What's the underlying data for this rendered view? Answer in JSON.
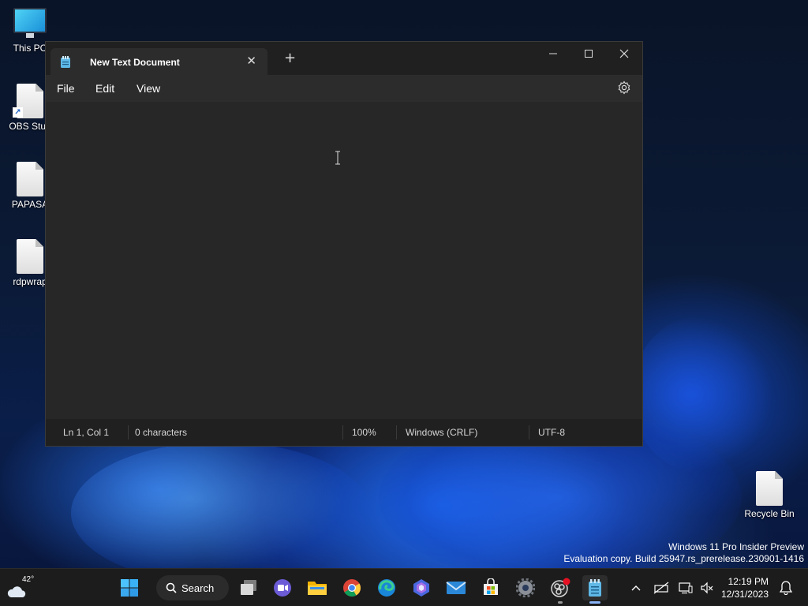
{
  "desktop": {
    "icons": [
      {
        "label": "This PC",
        "icon": "computer-icon"
      },
      {
        "label": "OBS Stud",
        "icon": "shortcut-file-icon"
      },
      {
        "label": "PAPASA",
        "icon": "file-icon"
      },
      {
        "label": "rdpwrap",
        "icon": "file-icon"
      },
      {
        "label": "Recycle Bin",
        "icon": "recycle-bin-icon"
      }
    ],
    "watermark": {
      "line1": "Windows 11 Pro Insider Preview",
      "line2": "Evaluation copy. Build 25947.rs_prerelease.230901-1416"
    }
  },
  "notepad": {
    "tab_title": "New Text Document",
    "menu": {
      "file": "File",
      "edit": "Edit",
      "view": "View"
    },
    "status": {
      "position": "Ln 1, Col 1",
      "characters": "0 characters",
      "zoom": "100%",
      "line_ending": "Windows (CRLF)",
      "encoding": "UTF-8"
    }
  },
  "taskbar": {
    "weather_temp": "42°",
    "search_label": "Search",
    "time": "12:19 PM",
    "date": "12/31/2023",
    "pinned": [
      "start-icon",
      "task-view-icon",
      "meet-icon",
      "file-explorer-icon",
      "chrome-icon",
      "edge-icon",
      "copilot-icon",
      "mail-icon",
      "store-icon",
      "settings-icon",
      "obs-icon",
      "notepad-icon"
    ]
  },
  "colors": {
    "window_bg": "#272727",
    "titlebar_bg": "#202020",
    "taskbar_bg": "#1c1c1c",
    "accent": "#8ab4f8"
  }
}
